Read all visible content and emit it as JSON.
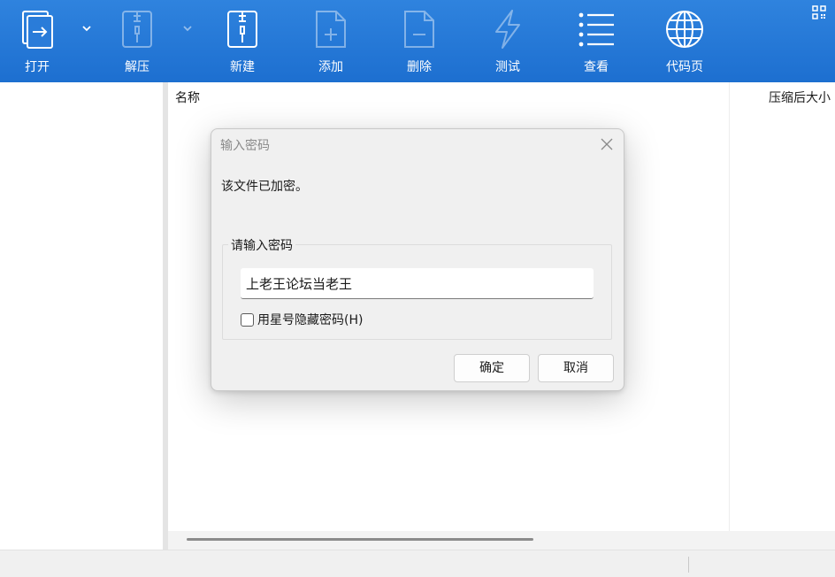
{
  "toolbar": {
    "buttons": [
      {
        "label": "打开",
        "icon": "open-icon",
        "enabled": true,
        "has_dropdown": true
      },
      {
        "label": "解压",
        "icon": "extract-icon",
        "enabled": false,
        "has_dropdown": true
      },
      {
        "label": "新建",
        "icon": "new-archive-icon",
        "enabled": true,
        "has_dropdown": false
      },
      {
        "label": "添加",
        "icon": "add-file-icon",
        "enabled": false,
        "has_dropdown": false
      },
      {
        "label": "删除",
        "icon": "delete-file-icon",
        "enabled": false,
        "has_dropdown": false
      },
      {
        "label": "测试",
        "icon": "test-icon",
        "enabled": false,
        "has_dropdown": false
      },
      {
        "label": "查看",
        "icon": "view-list-icon",
        "enabled": true,
        "has_dropdown": false
      },
      {
        "label": "代码页",
        "icon": "globe-icon",
        "enabled": true,
        "has_dropdown": false
      }
    ],
    "color": "#2278d8"
  },
  "file_list": {
    "columns": [
      "名称",
      "压缩后大小"
    ]
  },
  "dialog": {
    "title": "输入密码",
    "message": "该文件已加密。",
    "group_label": "请输入密码",
    "password_value": "上老王论坛当老王",
    "hide_with_asterisks_label": "用星号隐藏密码(H)",
    "hide_with_asterisks_checked": false,
    "ok_label": "确定",
    "cancel_label": "取消"
  }
}
